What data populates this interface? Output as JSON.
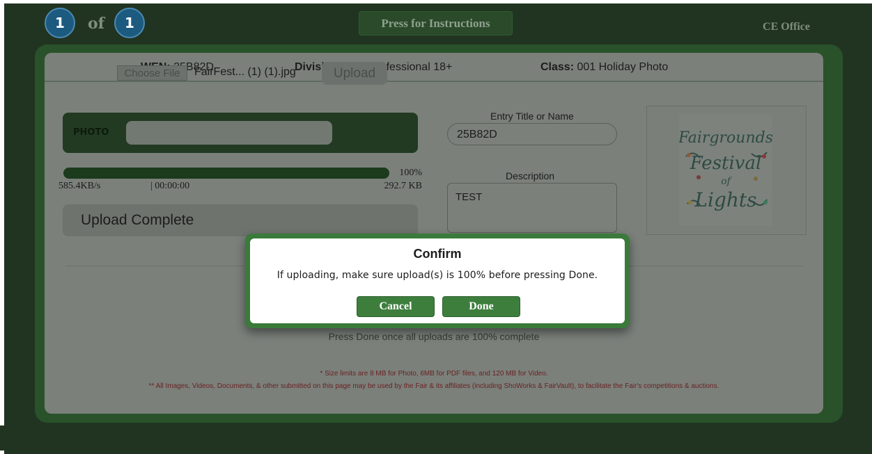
{
  "nav": {
    "current": "1",
    "of_text": "of",
    "total": "1",
    "instructions_label": "Press for Instructions",
    "office_label": "CE Office"
  },
  "header": {
    "wen_label": "WEN:",
    "wen_value": "25B82D",
    "division_label": "Division:",
    "division_value": "Non-Professional 18+",
    "class_label": "Class:",
    "class_value": "001 Holiday Photo"
  },
  "upload": {
    "photo_label": "PHOTO",
    "choose_file_label": "Choose File",
    "file_name": "FairFest... (1) (1).jpg",
    "upload_button": "Upload",
    "progress_percent": "100%",
    "progress_value": 1.0,
    "speed": "585.4KB/s",
    "elapsed": "| 00:00:00",
    "size": "292.7 KB",
    "status": "Upload Complete"
  },
  "entry": {
    "title_label": "Entry Title or Name",
    "title_value": "25B82D",
    "description_label": "Description",
    "description_value": "TEST"
  },
  "logo": {
    "line1": "Fairgrounds",
    "line2": "Festival",
    "line3": "of",
    "line4": "Lights"
  },
  "footer": {
    "press_done": "Press Done once all uploads are 100% complete",
    "size_note": "* Size limits are 8 MB for Photo, 6MB for PDF files, and 120 MB for Video.",
    "usage_note": "** All Images, Videos, Documents, & other submitted on this page may be used by the Fair & its affiliates (including ShoWorks & FairVault), to facilitate the Fair's competitions & auctions."
  },
  "dialog": {
    "title": "Confirm",
    "message": "If uploading, make sure upload(s) is 100% before pressing Done.",
    "cancel_label": "Cancel",
    "done_label": "Done"
  },
  "colors": {
    "overlay_bg": "#213421",
    "accent": "#3d7e3d",
    "panel_dimmed": "#7b807b"
  }
}
